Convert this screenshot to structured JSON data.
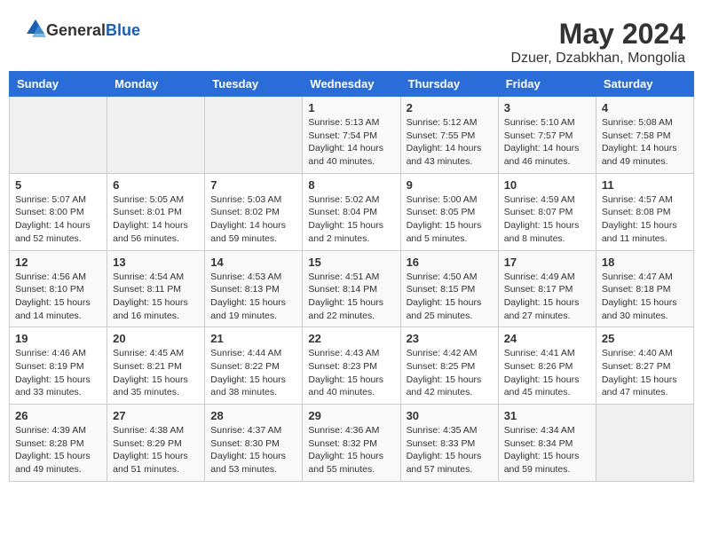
{
  "header": {
    "logo_general": "General",
    "logo_blue": "Blue",
    "title": "May 2024",
    "subtitle": "Dzuer, Dzabkhan, Mongolia"
  },
  "weekdays": [
    "Sunday",
    "Monday",
    "Tuesday",
    "Wednesday",
    "Thursday",
    "Friday",
    "Saturday"
  ],
  "weeks": [
    [
      {
        "day": "",
        "info": ""
      },
      {
        "day": "",
        "info": ""
      },
      {
        "day": "",
        "info": ""
      },
      {
        "day": "1",
        "info": "Sunrise: 5:13 AM\nSunset: 7:54 PM\nDaylight: 14 hours\nand 40 minutes."
      },
      {
        "day": "2",
        "info": "Sunrise: 5:12 AM\nSunset: 7:55 PM\nDaylight: 14 hours\nand 43 minutes."
      },
      {
        "day": "3",
        "info": "Sunrise: 5:10 AM\nSunset: 7:57 PM\nDaylight: 14 hours\nand 46 minutes."
      },
      {
        "day": "4",
        "info": "Sunrise: 5:08 AM\nSunset: 7:58 PM\nDaylight: 14 hours\nand 49 minutes."
      }
    ],
    [
      {
        "day": "5",
        "info": "Sunrise: 5:07 AM\nSunset: 8:00 PM\nDaylight: 14 hours\nand 52 minutes."
      },
      {
        "day": "6",
        "info": "Sunrise: 5:05 AM\nSunset: 8:01 PM\nDaylight: 14 hours\nand 56 minutes."
      },
      {
        "day": "7",
        "info": "Sunrise: 5:03 AM\nSunset: 8:02 PM\nDaylight: 14 hours\nand 59 minutes."
      },
      {
        "day": "8",
        "info": "Sunrise: 5:02 AM\nSunset: 8:04 PM\nDaylight: 15 hours\nand 2 minutes."
      },
      {
        "day": "9",
        "info": "Sunrise: 5:00 AM\nSunset: 8:05 PM\nDaylight: 15 hours\nand 5 minutes."
      },
      {
        "day": "10",
        "info": "Sunrise: 4:59 AM\nSunset: 8:07 PM\nDaylight: 15 hours\nand 8 minutes."
      },
      {
        "day": "11",
        "info": "Sunrise: 4:57 AM\nSunset: 8:08 PM\nDaylight: 15 hours\nand 11 minutes."
      }
    ],
    [
      {
        "day": "12",
        "info": "Sunrise: 4:56 AM\nSunset: 8:10 PM\nDaylight: 15 hours\nand 14 minutes."
      },
      {
        "day": "13",
        "info": "Sunrise: 4:54 AM\nSunset: 8:11 PM\nDaylight: 15 hours\nand 16 minutes."
      },
      {
        "day": "14",
        "info": "Sunrise: 4:53 AM\nSunset: 8:13 PM\nDaylight: 15 hours\nand 19 minutes."
      },
      {
        "day": "15",
        "info": "Sunrise: 4:51 AM\nSunset: 8:14 PM\nDaylight: 15 hours\nand 22 minutes."
      },
      {
        "day": "16",
        "info": "Sunrise: 4:50 AM\nSunset: 8:15 PM\nDaylight: 15 hours\nand 25 minutes."
      },
      {
        "day": "17",
        "info": "Sunrise: 4:49 AM\nSunset: 8:17 PM\nDaylight: 15 hours\nand 27 minutes."
      },
      {
        "day": "18",
        "info": "Sunrise: 4:47 AM\nSunset: 8:18 PM\nDaylight: 15 hours\nand 30 minutes."
      }
    ],
    [
      {
        "day": "19",
        "info": "Sunrise: 4:46 AM\nSunset: 8:19 PM\nDaylight: 15 hours\nand 33 minutes."
      },
      {
        "day": "20",
        "info": "Sunrise: 4:45 AM\nSunset: 8:21 PM\nDaylight: 15 hours\nand 35 minutes."
      },
      {
        "day": "21",
        "info": "Sunrise: 4:44 AM\nSunset: 8:22 PM\nDaylight: 15 hours\nand 38 minutes."
      },
      {
        "day": "22",
        "info": "Sunrise: 4:43 AM\nSunset: 8:23 PM\nDaylight: 15 hours\nand 40 minutes."
      },
      {
        "day": "23",
        "info": "Sunrise: 4:42 AM\nSunset: 8:25 PM\nDaylight: 15 hours\nand 42 minutes."
      },
      {
        "day": "24",
        "info": "Sunrise: 4:41 AM\nSunset: 8:26 PM\nDaylight: 15 hours\nand 45 minutes."
      },
      {
        "day": "25",
        "info": "Sunrise: 4:40 AM\nSunset: 8:27 PM\nDaylight: 15 hours\nand 47 minutes."
      }
    ],
    [
      {
        "day": "26",
        "info": "Sunrise: 4:39 AM\nSunset: 8:28 PM\nDaylight: 15 hours\nand 49 minutes."
      },
      {
        "day": "27",
        "info": "Sunrise: 4:38 AM\nSunset: 8:29 PM\nDaylight: 15 hours\nand 51 minutes."
      },
      {
        "day": "28",
        "info": "Sunrise: 4:37 AM\nSunset: 8:30 PM\nDaylight: 15 hours\nand 53 minutes."
      },
      {
        "day": "29",
        "info": "Sunrise: 4:36 AM\nSunset: 8:32 PM\nDaylight: 15 hours\nand 55 minutes."
      },
      {
        "day": "30",
        "info": "Sunrise: 4:35 AM\nSunset: 8:33 PM\nDaylight: 15 hours\nand 57 minutes."
      },
      {
        "day": "31",
        "info": "Sunrise: 4:34 AM\nSunset: 8:34 PM\nDaylight: 15 hours\nand 59 minutes."
      },
      {
        "day": "",
        "info": ""
      }
    ]
  ]
}
